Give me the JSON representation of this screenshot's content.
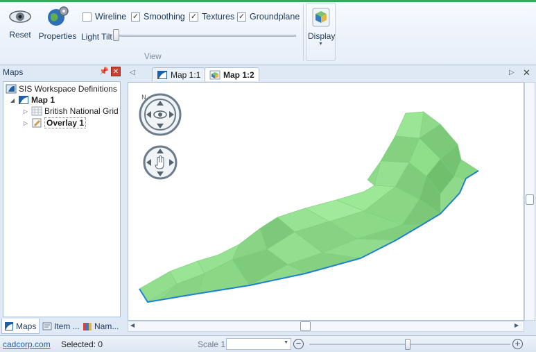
{
  "ribbon": {
    "buttons": {
      "reset": "Reset",
      "properties": "Properties",
      "display": "Display"
    },
    "checkboxes": [
      {
        "label": "Wireline",
        "checked": false
      },
      {
        "label": "Smoothing",
        "checked": true
      },
      {
        "label": "Textures",
        "checked": true
      },
      {
        "label": "Groundplane",
        "checked": true
      }
    ],
    "light_tilt_label": "Light Tilt",
    "light_tilt_value": 0,
    "group_label": "View"
  },
  "maps_panel": {
    "title": "Maps",
    "tree": {
      "root": "SIS Workspace Definitions",
      "map": "Map 1",
      "children": [
        "British National Grid",
        "Overlay 1"
      ]
    },
    "tabs": [
      "Maps",
      "Item ...",
      "Nam..."
    ]
  },
  "map_tabs": [
    "Map 1:1",
    "Map 1:2"
  ],
  "status": {
    "link": "cadcorp.com",
    "selected": "Selected: 0",
    "scale_label": "Scale 1:",
    "scale_value": ""
  },
  "colors": {
    "terrain": "#8fd98b",
    "terrain_dark": "#6fbf6c",
    "edge": "#1e7fd6",
    "accent": "#3aa85a"
  }
}
